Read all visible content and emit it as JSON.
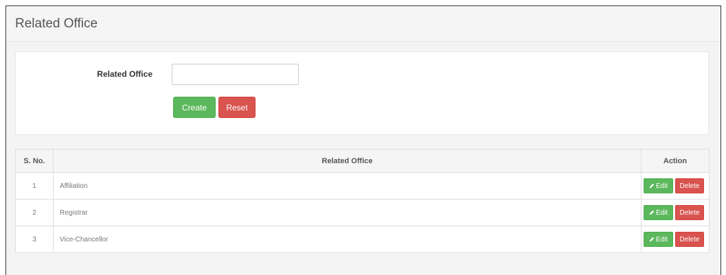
{
  "panel": {
    "title": "Related Office"
  },
  "form": {
    "label": "Related Office",
    "create_label": "Create",
    "reset_label": "Reset"
  },
  "table": {
    "headers": [
      "S. No.",
      "Related Office",
      "Action"
    ],
    "rows": [
      {
        "sno": "1",
        "office": "Affiliation"
      },
      {
        "sno": "2",
        "office": "Registrar"
      },
      {
        "sno": "3",
        "office": "Vice-Chancellor"
      }
    ],
    "edit_label": "Edit",
    "delete_label": "Delete",
    "edit_icon": "pencil-icon"
  },
  "colors": {
    "success": "#5cb85c",
    "danger": "#d9534f",
    "frame_border": "#333333"
  }
}
